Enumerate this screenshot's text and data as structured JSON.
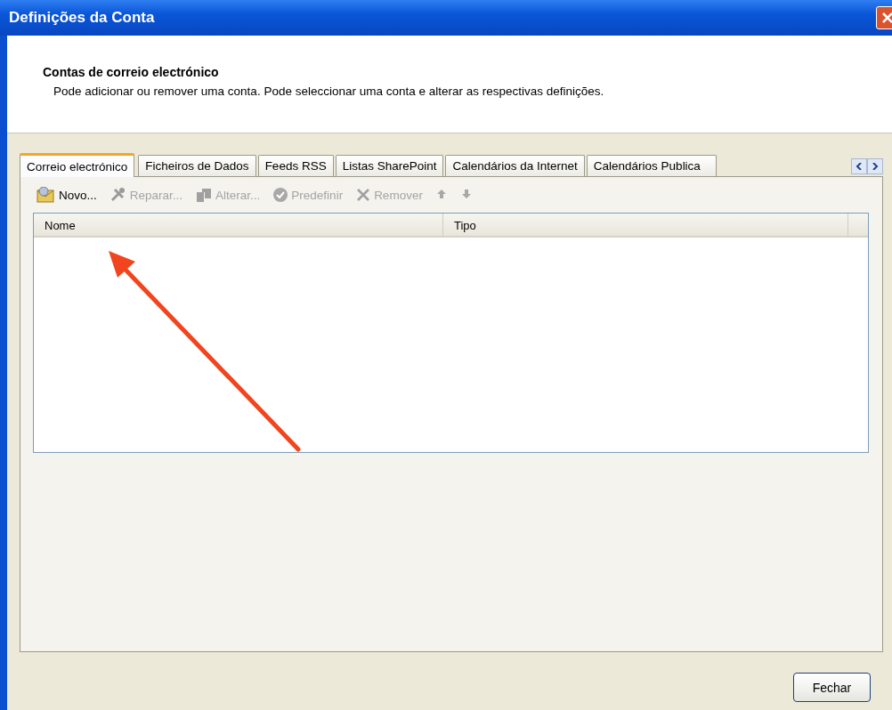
{
  "window": {
    "title": "Definições da Conta"
  },
  "header": {
    "title": "Contas de correio electrónico",
    "description": "Pode adicionar ou remover uma conta. Pode seleccionar uma conta e alterar as respectivas definições."
  },
  "tabs": [
    {
      "label": "Correio electrónico",
      "selected": true
    },
    {
      "label": "Ficheiros de Dados",
      "selected": false
    },
    {
      "label": "Feeds RSS",
      "selected": false
    },
    {
      "label": "Listas SharePoint",
      "selected": false
    },
    {
      "label": "Calendários da Internet",
      "selected": false
    },
    {
      "label": "Calendários Publica",
      "selected": false
    }
  ],
  "toolbar": [
    {
      "kind": "new",
      "label": "Novo...",
      "disabled": false
    },
    {
      "kind": "repair",
      "label": "Reparar...",
      "disabled": true
    },
    {
      "kind": "change",
      "label": "Alterar...",
      "disabled": true
    },
    {
      "kind": "default",
      "label": "Predefinir",
      "disabled": true
    },
    {
      "kind": "remove",
      "label": "Remover",
      "disabled": true
    },
    {
      "kind": "up",
      "disabled": true
    },
    {
      "kind": "down",
      "disabled": true
    }
  ],
  "table": {
    "columns": [
      "Nome",
      "Tipo"
    ]
  },
  "buttons": [
    "Fechar"
  ]
}
